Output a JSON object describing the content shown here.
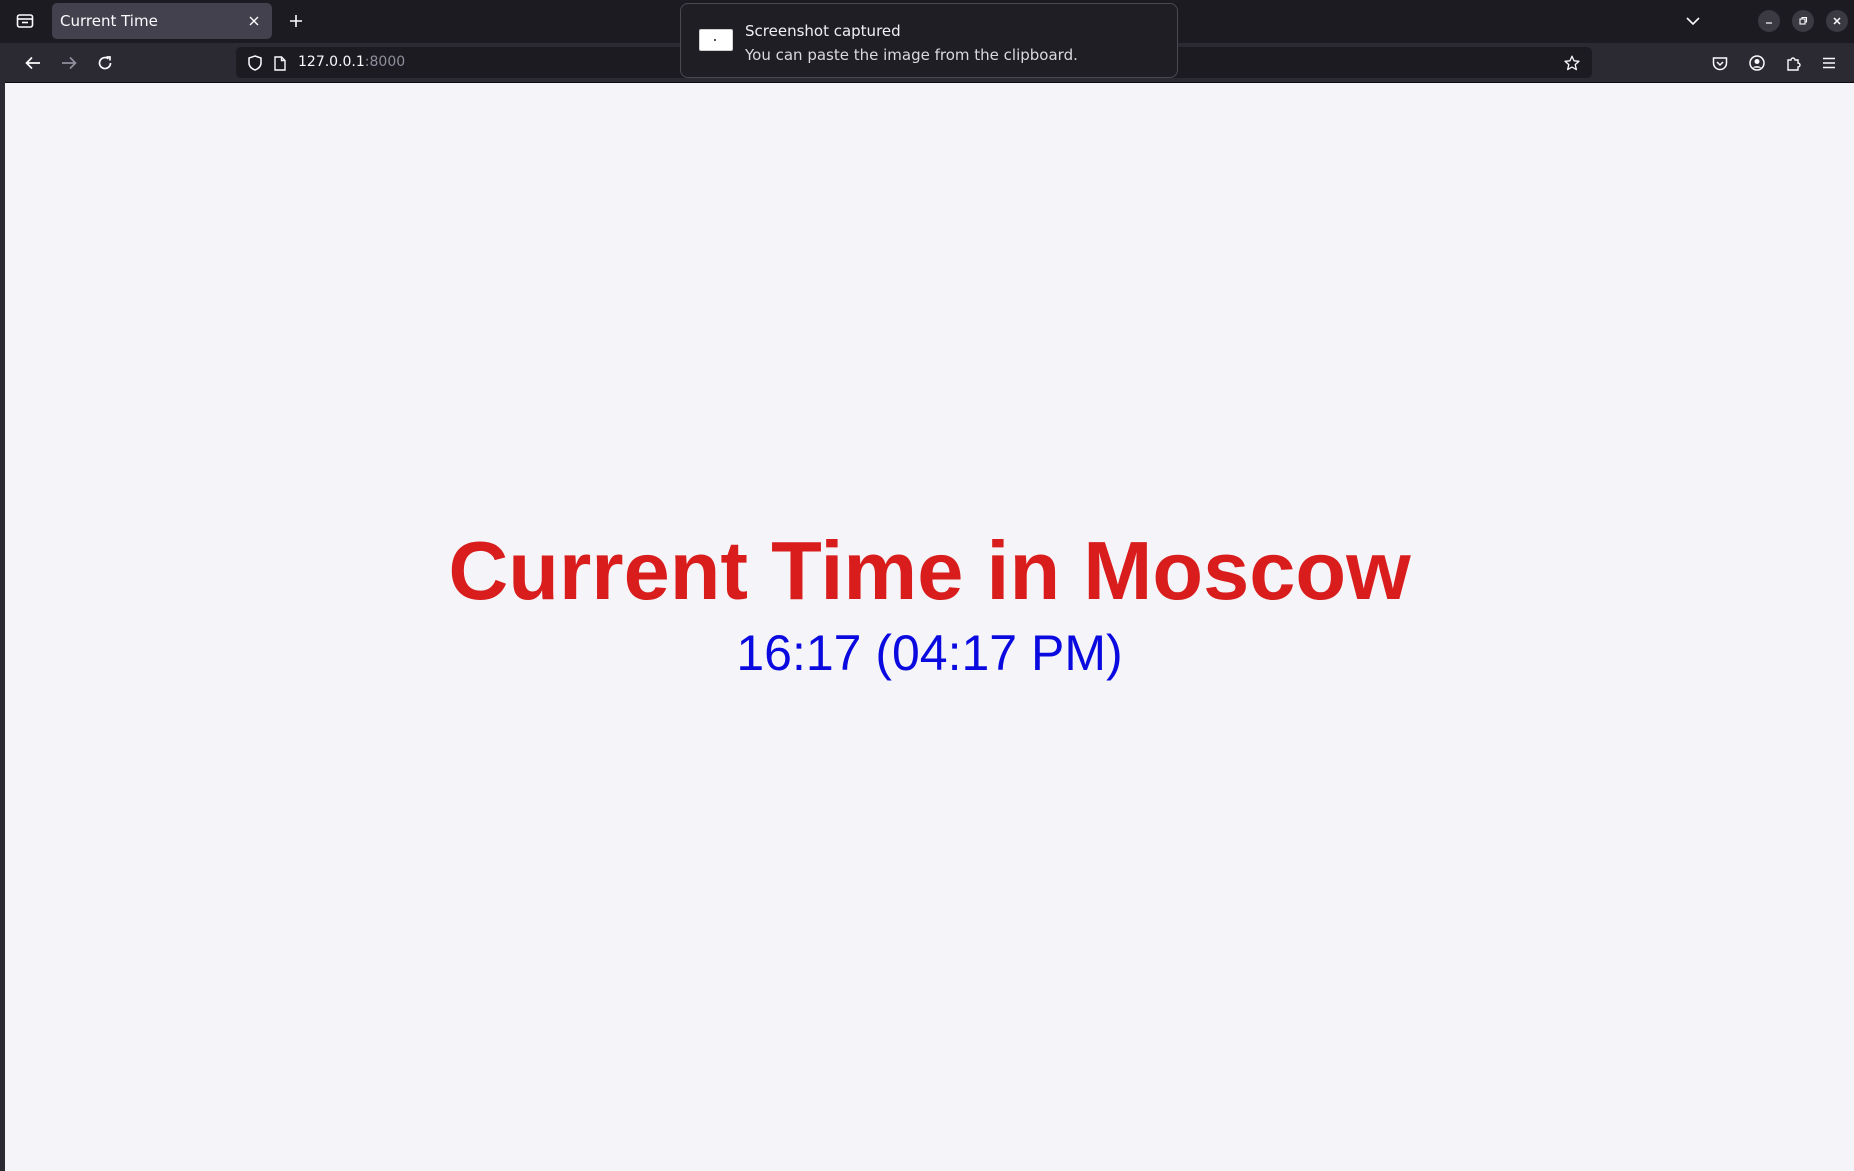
{
  "browser": {
    "tab": {
      "title": "Current Time"
    },
    "url": {
      "host": "127.0.0.1",
      "port": ":8000"
    }
  },
  "notification": {
    "title": "Screenshot captured",
    "body": "You can paste the image from the clipboard."
  },
  "page": {
    "heading": "Current Time in Moscow",
    "time": "16:17 (04:17 PM)"
  },
  "colors": {
    "heading": "#d91d1d",
    "time": "#0a0ae0",
    "page_background": "#f5f4f8",
    "toolbar": "#2b2a33"
  }
}
